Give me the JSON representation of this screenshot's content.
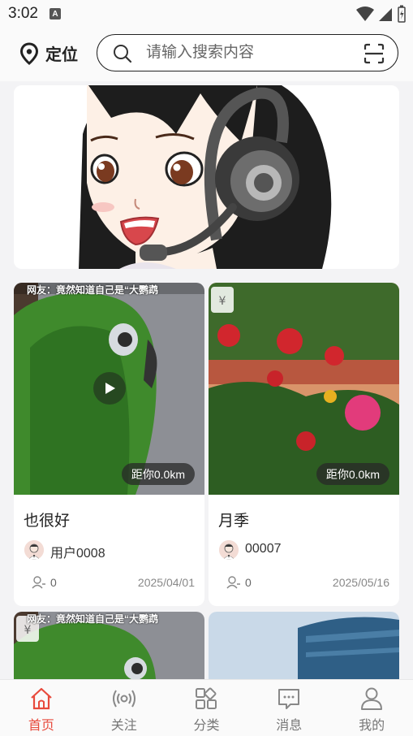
{
  "status_bar": {
    "time": "3:02",
    "notif_icon": "A"
  },
  "header": {
    "location_label": "定位",
    "search_placeholder": "请输入搜索内容"
  },
  "cards": [
    {
      "title": "也很好",
      "distance": "距你0.0km",
      "user": "用户0008",
      "count": "0",
      "date": "2025/04/01",
      "overlay_text": "网友：竟然知道自己是“大鹦鹉",
      "is_video": true
    },
    {
      "title": "月季",
      "distance": "距你0.0km",
      "user": "00007",
      "count": "0",
      "date": "2025/05/16",
      "is_video": false
    }
  ],
  "partial_cards": [
    {
      "overlay_text": "网友：竟然知道自己是“大鹦鹉"
    },
    {
      "overlay_text": ""
    }
  ],
  "bottom_nav": [
    {
      "label": "首页",
      "icon": "home-icon",
      "active": true
    },
    {
      "label": "关注",
      "icon": "broadcast-icon",
      "active": false
    },
    {
      "label": "分类",
      "icon": "category-icon",
      "active": false
    },
    {
      "label": "消息",
      "icon": "message-icon",
      "active": false
    },
    {
      "label": "我的",
      "icon": "user-icon",
      "active": false
    }
  ],
  "colors": {
    "accent": "#e84a3c",
    "background": "#f3f3f5"
  }
}
